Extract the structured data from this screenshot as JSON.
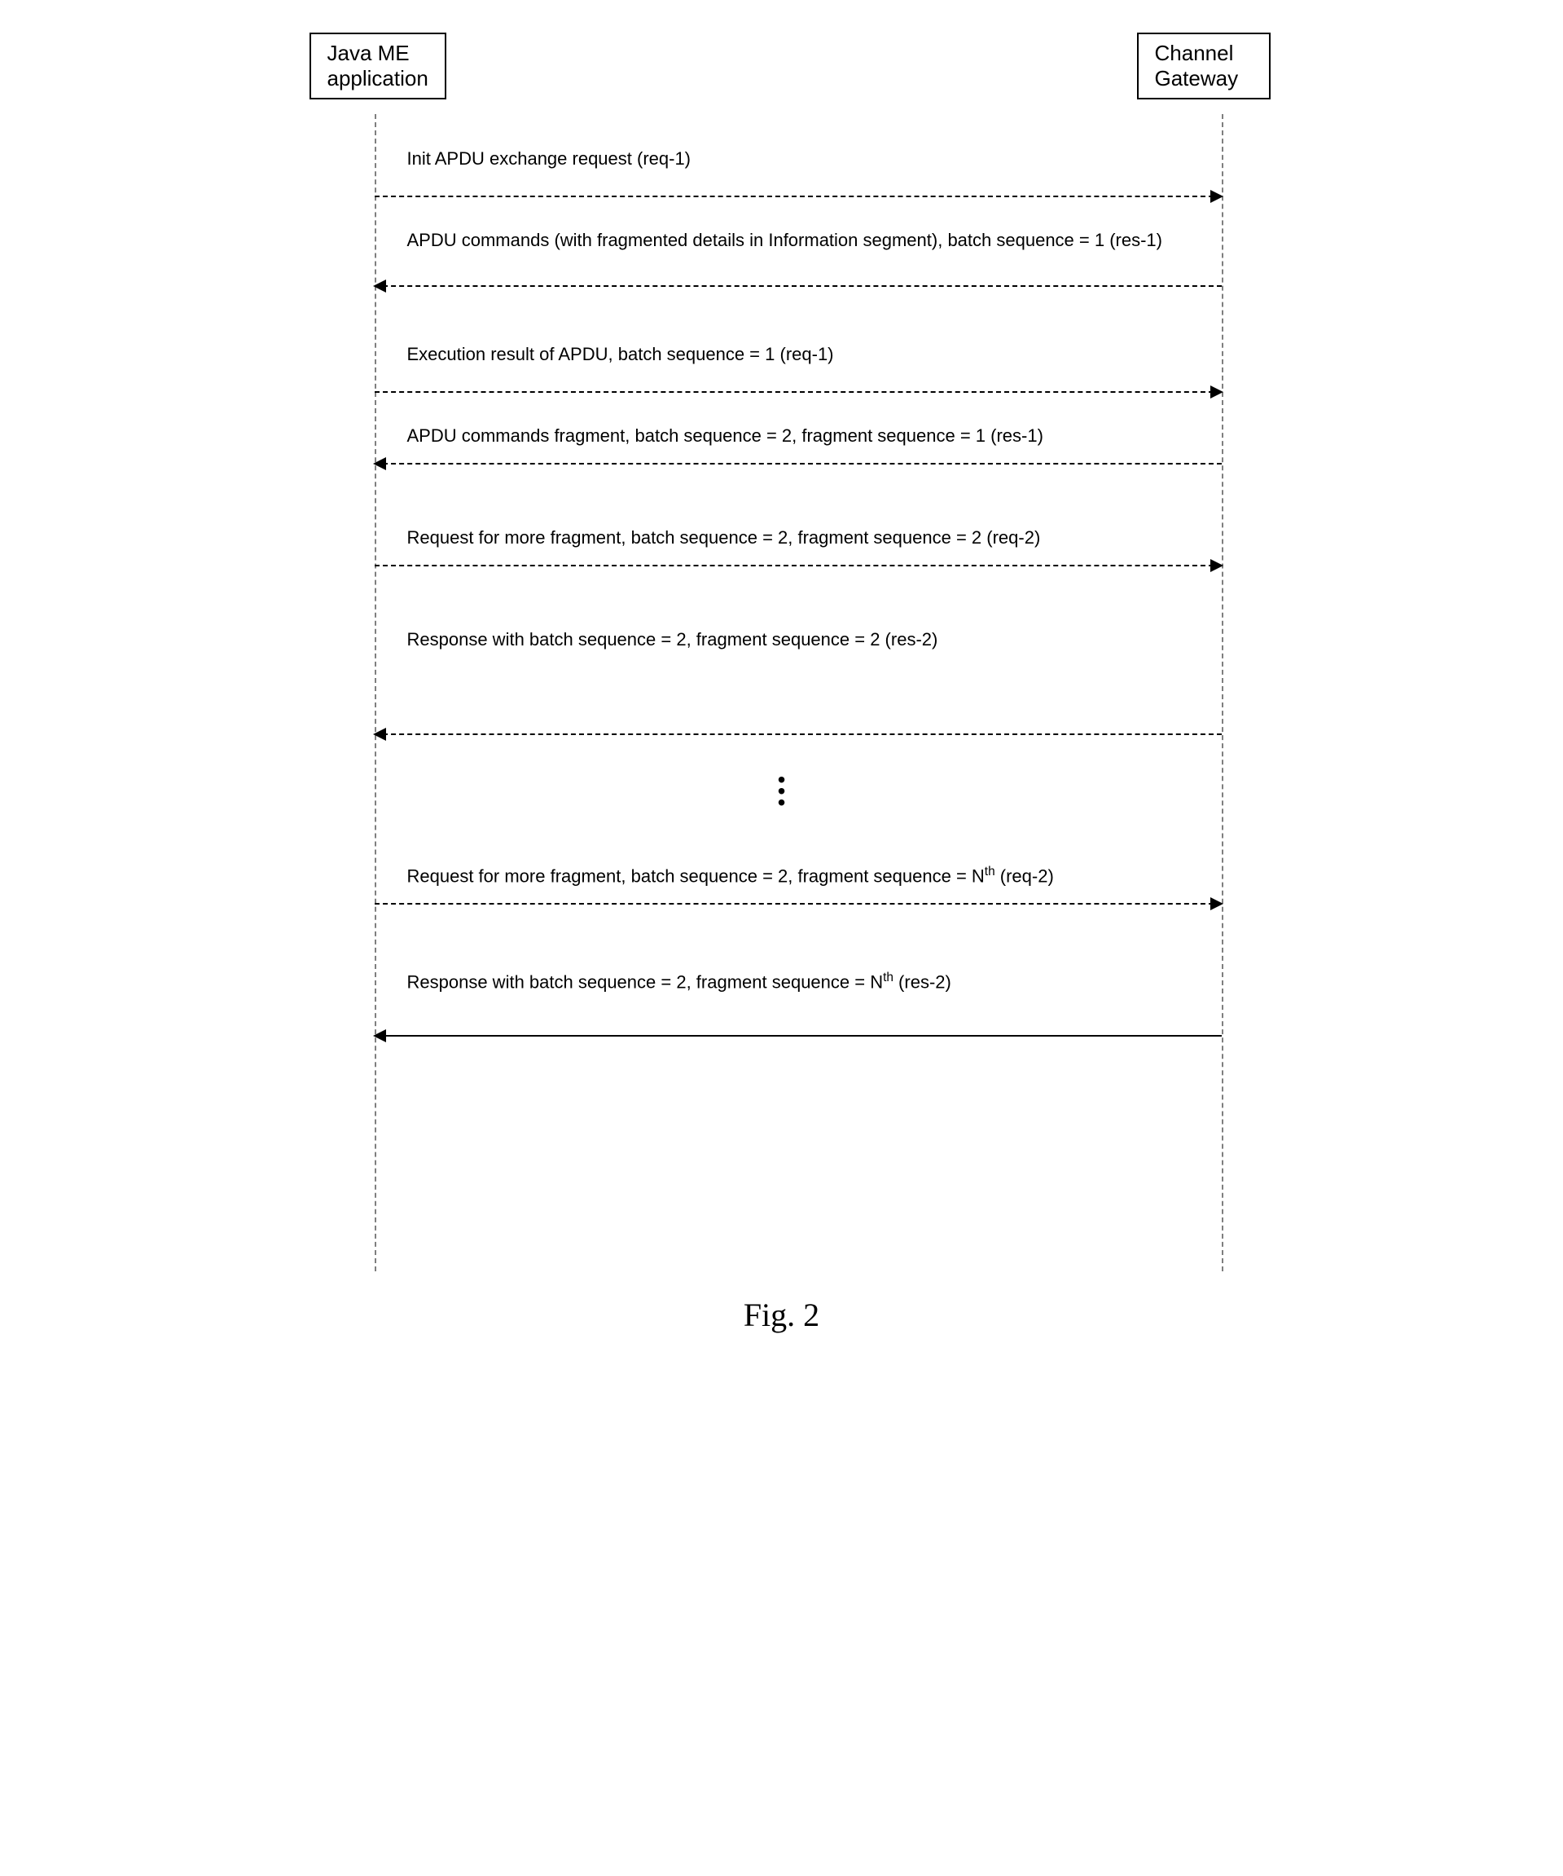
{
  "participants": {
    "left": "Java ME\napplication",
    "right": "Channel\nGateway"
  },
  "messages": {
    "m1": "Init APDU exchange request (req-1)",
    "m2": "APDU commands (with fragmented details in Information segment), batch sequence = 1 (res-1)",
    "m3": "Execution result of APDU, batch sequence = 1 (req-1)",
    "m4": "APDU commands fragment, batch sequence = 2, fragment sequence = 1 (res-1)",
    "m5": "Request for more fragment, batch sequence = 2, fragment sequence = 2 (req-2)",
    "m6": "Response with batch sequence = 2, fragment sequence = 2 (res-2)",
    "m7_pre": "Request for more fragment, batch sequence = 2, fragment sequence = N",
    "m7_post": " (req-2)",
    "m8_pre": "Response with batch sequence = 2, fragment sequence = N",
    "m8_post": " (res-2)",
    "sup": "th"
  },
  "figure_label": "Fig. 2"
}
